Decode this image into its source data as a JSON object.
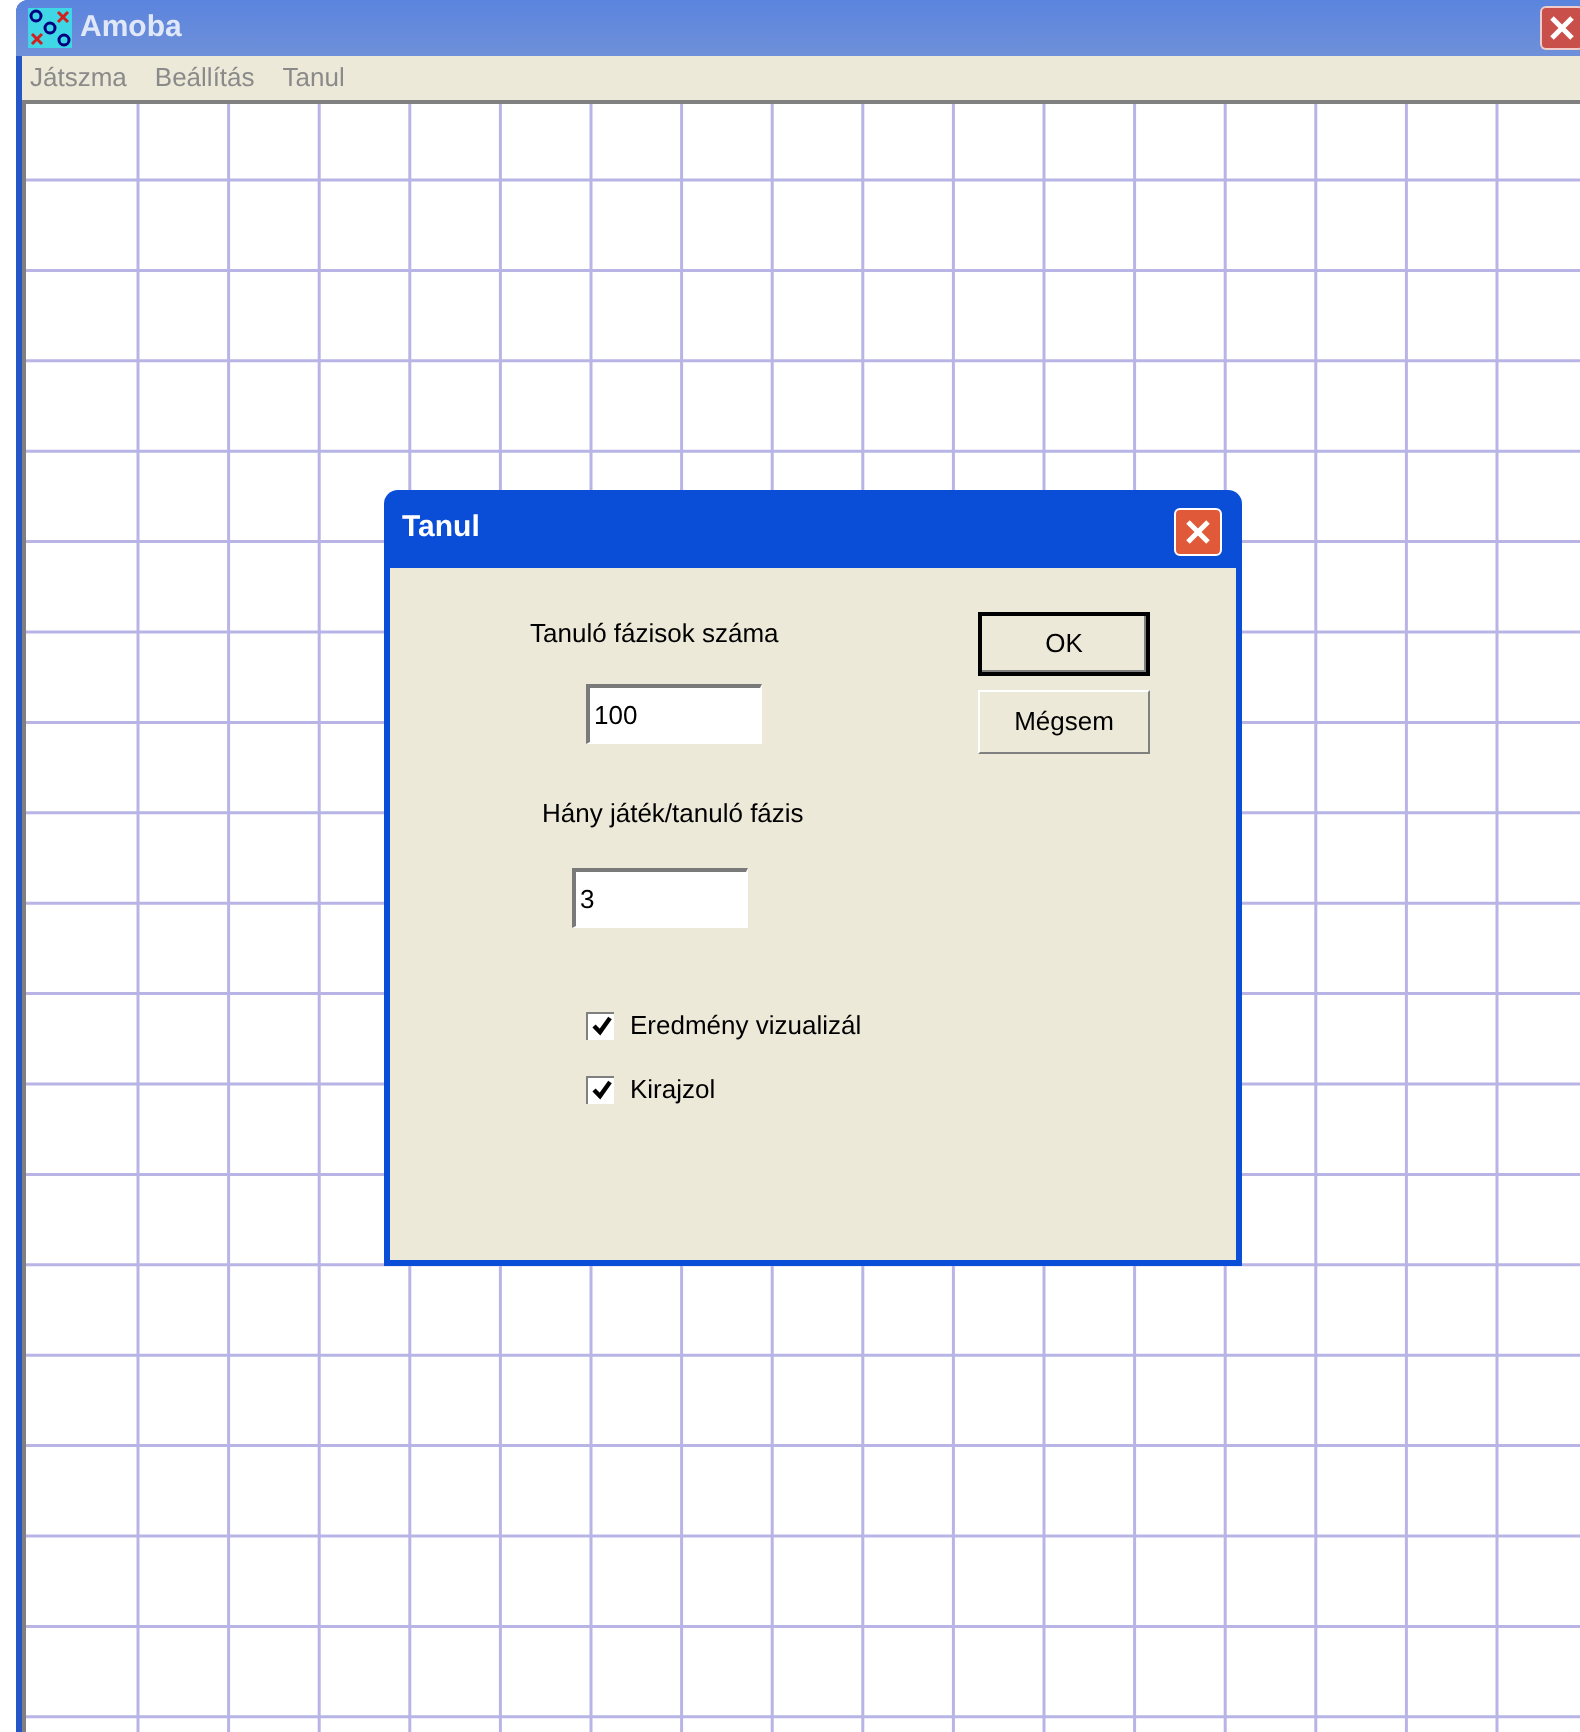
{
  "window": {
    "title": "Amoba"
  },
  "menu": [
    "Játszma",
    "Beállítás",
    "Tanul"
  ],
  "dialog": {
    "title": "Tanul",
    "fields": [
      {
        "label": "Tanuló fázisok száma",
        "value": "100"
      },
      {
        "label": "Hány játék/tanuló fázis",
        "value": "3"
      }
    ],
    "checkboxes": [
      {
        "label": "Eredmény vizualizál",
        "checked": true
      },
      {
        "label": "Kirajzol",
        "checked": true
      }
    ],
    "buttons": [
      {
        "label": "OK",
        "default": true
      },
      {
        "label": "Mégsem",
        "default": false
      }
    ]
  }
}
